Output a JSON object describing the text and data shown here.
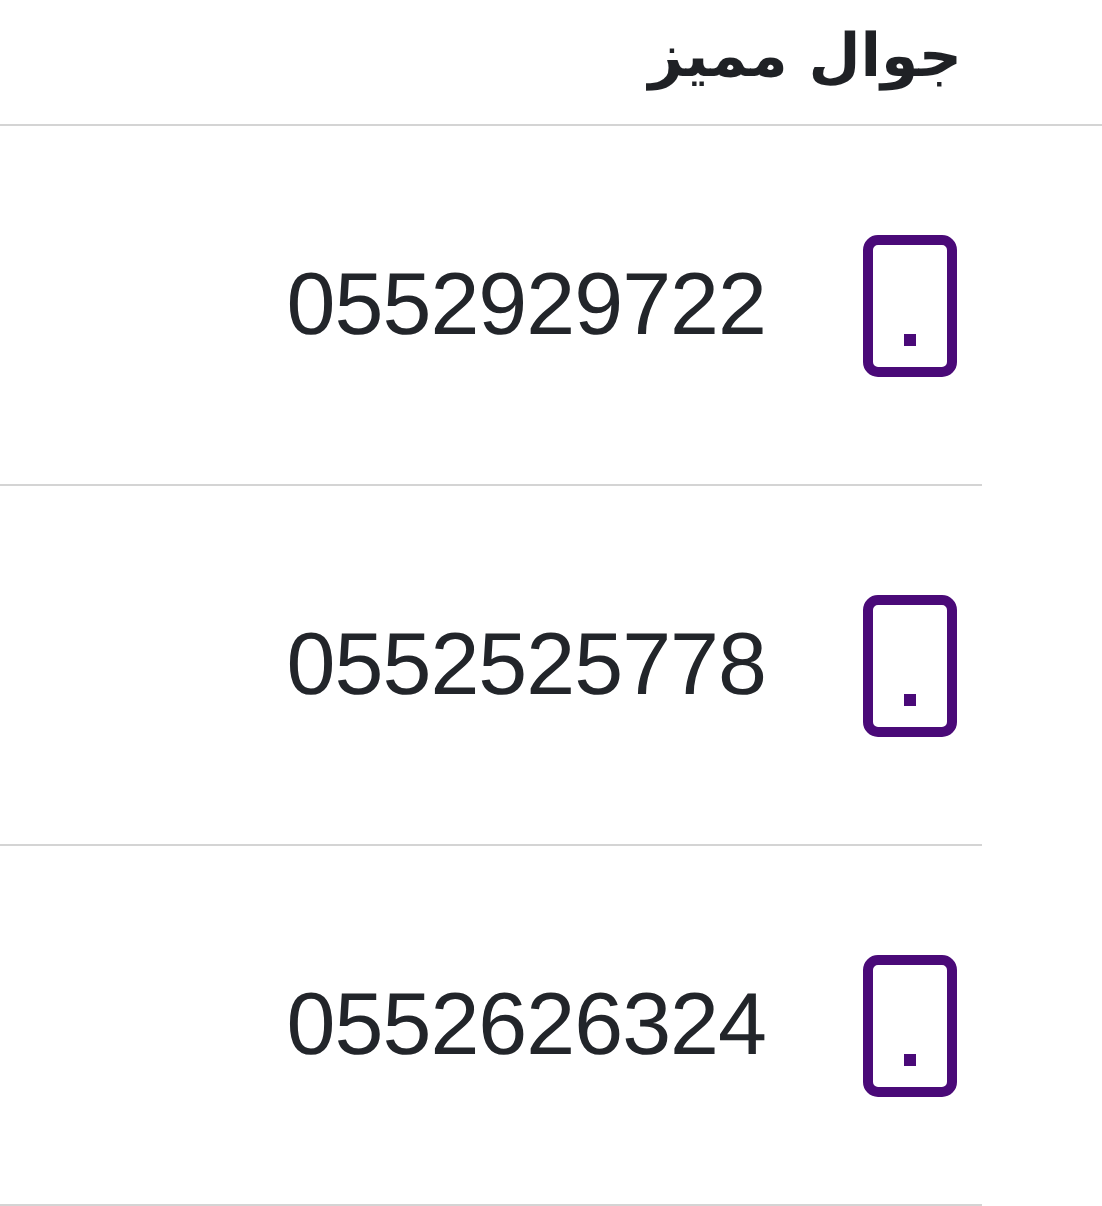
{
  "title": "جوال مميز",
  "phones": [
    {
      "number": "0552929722"
    },
    {
      "number": "0552525778"
    },
    {
      "number": "0552626324"
    }
  ]
}
